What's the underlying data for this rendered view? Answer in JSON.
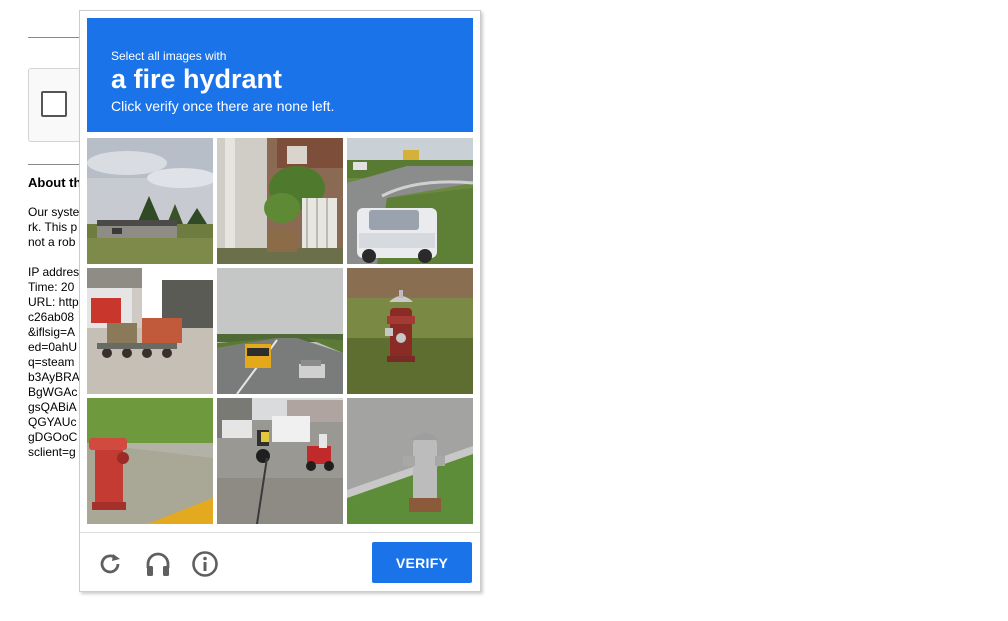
{
  "background": {
    "about_title": "About th",
    "about_lines": [
      "Our syste",
      "rk. This p",
      "not a rob"
    ],
    "info_lines": [
      "IP addres",
      "Time: 20",
      "URL: http",
      "c26ab08",
      "&iflsig=A",
      "ed=0ahU",
      "q=steam",
      "b3AyBRA",
      "BgWGAc",
      "gsQABiA",
      "QGYAUc",
      "gDGOoC",
      "sclient=g"
    ]
  },
  "challenge": {
    "instruction_small": "Select all images with",
    "target_object": "a fire hydrant",
    "instruction_sub": "Click verify once there are none left.",
    "header_color": "#1a73e8",
    "tiles": [
      {
        "scene": "field-with-trees-and-building"
      },
      {
        "scene": "house-porch-with-bushes"
      },
      {
        "scene": "highway-with-white-suv"
      },
      {
        "scene": "wagons-near-garage"
      },
      {
        "scene": "road-with-school-bus"
      },
      {
        "scene": "red-fire-hydrant-in-grass"
      },
      {
        "scene": "red-fire-hydrant-on-curb"
      },
      {
        "scene": "street-with-motorcycles"
      },
      {
        "scene": "silver-fire-hydrant-by-road"
      }
    ],
    "footer": {
      "reload_icon": "reload-icon",
      "audio_icon": "headphones-icon",
      "info_icon": "info-icon",
      "verify_label": "VERIFY"
    }
  }
}
